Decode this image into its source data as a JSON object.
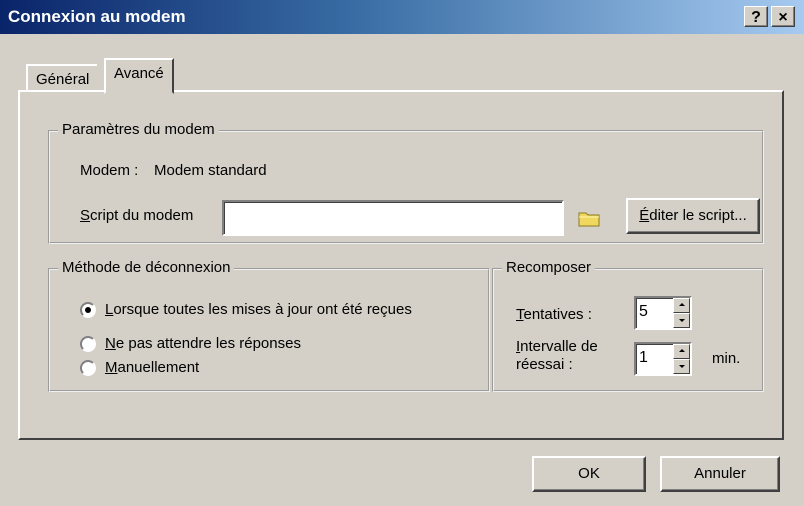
{
  "window": {
    "title": "Connexion au modem",
    "help_label": "?",
    "close_label": "×"
  },
  "tabs": [
    {
      "label": "Général",
      "active": false
    },
    {
      "label": "Avancé",
      "active": true
    }
  ],
  "modem_group": {
    "legend": "Paramètres du modem",
    "modem_label": "Modem :",
    "modem_value": "Modem standard",
    "script_label_u": "S",
    "script_label_rest": "cript du modem",
    "script_value": "",
    "browse_icon": "folder-icon",
    "edit_button_u": "É",
    "edit_button_rest": "diter le script..."
  },
  "disconnect_group": {
    "legend": "Méthode de déconnexion",
    "options": [
      {
        "u": "L",
        "rest": "orsque toutes les mises à jour ont été reçues",
        "selected": true
      },
      {
        "u": "N",
        "rest": "e pas attendre les réponses",
        "selected": false
      },
      {
        "u": "M",
        "rest": "anuellement",
        "selected": false
      }
    ]
  },
  "redial_group": {
    "legend": "Recomposer",
    "attempts_u": "T",
    "attempts_rest": "entatives :",
    "attempts_value": "5",
    "interval_u": "I",
    "interval_rest": "ntervalle de",
    "interval_line2": "réessai :",
    "interval_value": "1",
    "interval_unit": "min."
  },
  "footer": {
    "ok_label": "OK",
    "cancel_label": "Annuler"
  },
  "colors": {
    "title_gradient_start": "#0a246a",
    "title_gradient_end": "#a6caf0",
    "face": "#d4d0c8",
    "folder": "#f0d860"
  }
}
